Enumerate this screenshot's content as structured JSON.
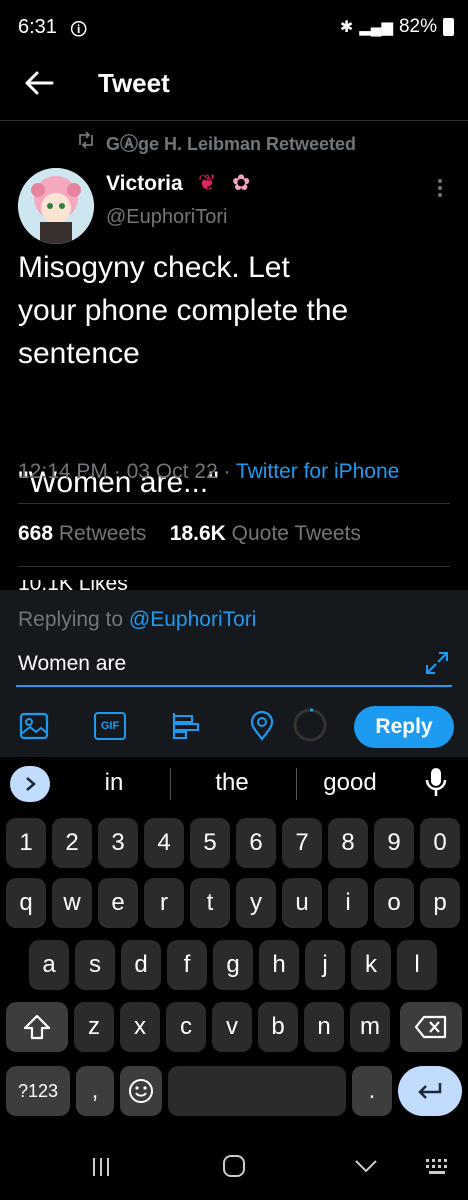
{
  "status_bar": {
    "time": "6:31",
    "battery": "82%"
  },
  "header": {
    "title": "Tweet"
  },
  "tweet": {
    "retweeted_by": "GⒶge H. Leibman Retweeted",
    "display_name": "Victoria",
    "username": "@EuphoriTori",
    "text": "Misogyny check. Let\nyour phone complete the\nsentence\n\n\n\"Women are...\"",
    "time": "12:14 PM",
    "date": "03 Oct 22",
    "source": "Twitter for iPhone",
    "retweets_count": "668",
    "retweets_label": "Retweets",
    "quote_count": "18.6K",
    "quote_label": "Quote Tweets",
    "likes_partial": "10.1K Likes"
  },
  "composer": {
    "replying_prefix": "Replying to",
    "replying_handle": "@EuphoriTori",
    "input_value": "Women are",
    "reply_button": "Reply",
    "gif_label": "GIF"
  },
  "keyboard": {
    "suggestions": [
      "in",
      "the",
      "good"
    ],
    "row_numbers": [
      "1",
      "2",
      "3",
      "4",
      "5",
      "6",
      "7",
      "8",
      "9",
      "0"
    ],
    "row_q": [
      "q",
      "w",
      "e",
      "r",
      "t",
      "y",
      "u",
      "i",
      "o",
      "p"
    ],
    "row_a": [
      "a",
      "s",
      "d",
      "f",
      "g",
      "h",
      "j",
      "k",
      "l"
    ],
    "row_z": [
      "z",
      "x",
      "c",
      "v",
      "b",
      "n",
      "m"
    ],
    "symbols_key": "?123",
    "comma_key": ",",
    "period_key": "."
  },
  "colors": {
    "accent": "#1d9bf0",
    "background": "#000000",
    "muted": "#71767b"
  }
}
